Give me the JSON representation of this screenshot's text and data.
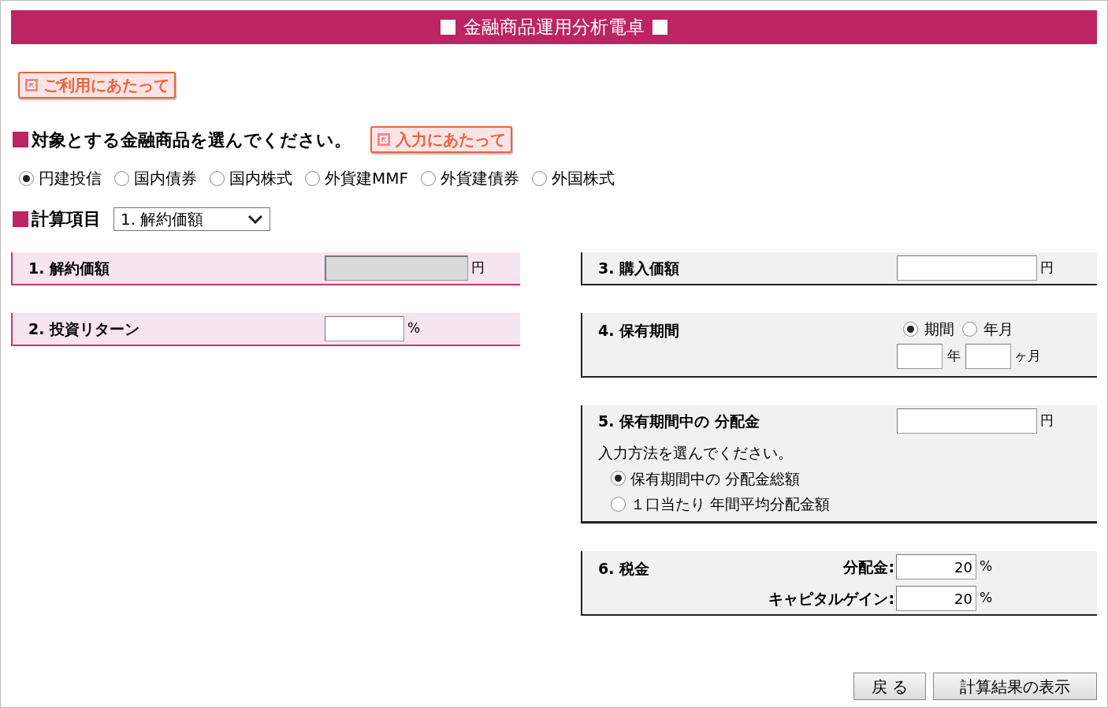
{
  "header": {
    "title": "金融商品運用分析電卓"
  },
  "usage_button": "ご利用にあたって",
  "product_section": {
    "heading": "対象とする金融商品を選んでください。",
    "help_button": "入力にあたって",
    "options": [
      {
        "label": "円建投信",
        "selected": true
      },
      {
        "label": "国内債券",
        "selected": false
      },
      {
        "label": "国内株式",
        "selected": false
      },
      {
        "label": "外貨建MMF",
        "selected": false
      },
      {
        "label": "外貨建債券",
        "selected": false
      },
      {
        "label": "外国株式",
        "selected": false
      }
    ]
  },
  "calc_item": {
    "label": "計算項目",
    "value": "1. 解約価額"
  },
  "left_panels": [
    {
      "label": "1. 解約価額",
      "kind": "amount",
      "disabled": true,
      "unit": "円"
    },
    {
      "label": "2. 投資リターン",
      "kind": "percent",
      "disabled": false,
      "unit": "%"
    }
  ],
  "purchase": {
    "label": "3. 購入価額",
    "unit": "円"
  },
  "holding": {
    "label": "4. 保有期間",
    "modes": [
      {
        "label": "期間",
        "selected": true
      },
      {
        "label": "年月",
        "selected": false
      }
    ],
    "year_unit": "年",
    "month_unit": "ヶ月"
  },
  "distribution": {
    "label": "5. 保有期間中の 分配金",
    "unit": "円",
    "prompt": "入力方法を選んでください。",
    "options": [
      {
        "label": "保有期間中の 分配金総額",
        "selected": true
      },
      {
        "label": "１口当たり 年間平均分配金額",
        "selected": false
      }
    ]
  },
  "tax": {
    "label": "6. 税金",
    "rows": [
      {
        "label": "分配金:",
        "value": "20",
        "unit": "%"
      },
      {
        "label": "キャピタルゲイン:",
        "value": "20",
        "unit": "%"
      }
    ]
  },
  "buttons": [
    "戻 る",
    "計算結果の表示"
  ]
}
